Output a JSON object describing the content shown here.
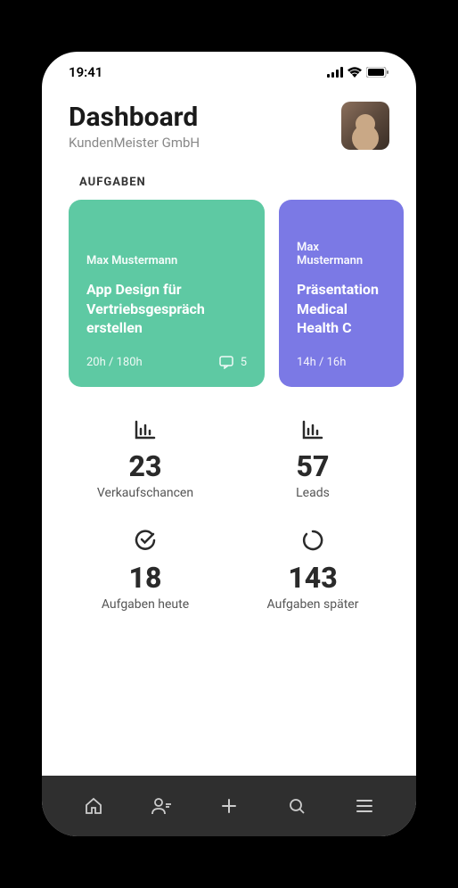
{
  "status": {
    "time": "19:41"
  },
  "header": {
    "title": "Dashboard",
    "subtitle": "KundenMeister GmbH"
  },
  "section_label": "AUFGABEN",
  "cards": [
    {
      "person": "Max Mustermann",
      "title": "App Design für Vertriebsgespräch erstellen",
      "time": "20h / 180h",
      "comments": "5"
    },
    {
      "person": "Max Mustermann",
      "title": "Präsentation Medical Health C",
      "time": "14h / 16h"
    }
  ],
  "stats": [
    {
      "icon": "bar-chart",
      "value": "23",
      "label": "Verkaufschancen"
    },
    {
      "icon": "bar-chart",
      "value": "57",
      "label": "Leads"
    },
    {
      "icon": "check-circle",
      "value": "18",
      "label": "Aufgaben heute"
    },
    {
      "icon": "progress-circle",
      "value": "143",
      "label": "Aufgaben später"
    }
  ],
  "nav": [
    {
      "name": "home"
    },
    {
      "name": "user-remove"
    },
    {
      "name": "add"
    },
    {
      "name": "search"
    },
    {
      "name": "menu"
    }
  ]
}
